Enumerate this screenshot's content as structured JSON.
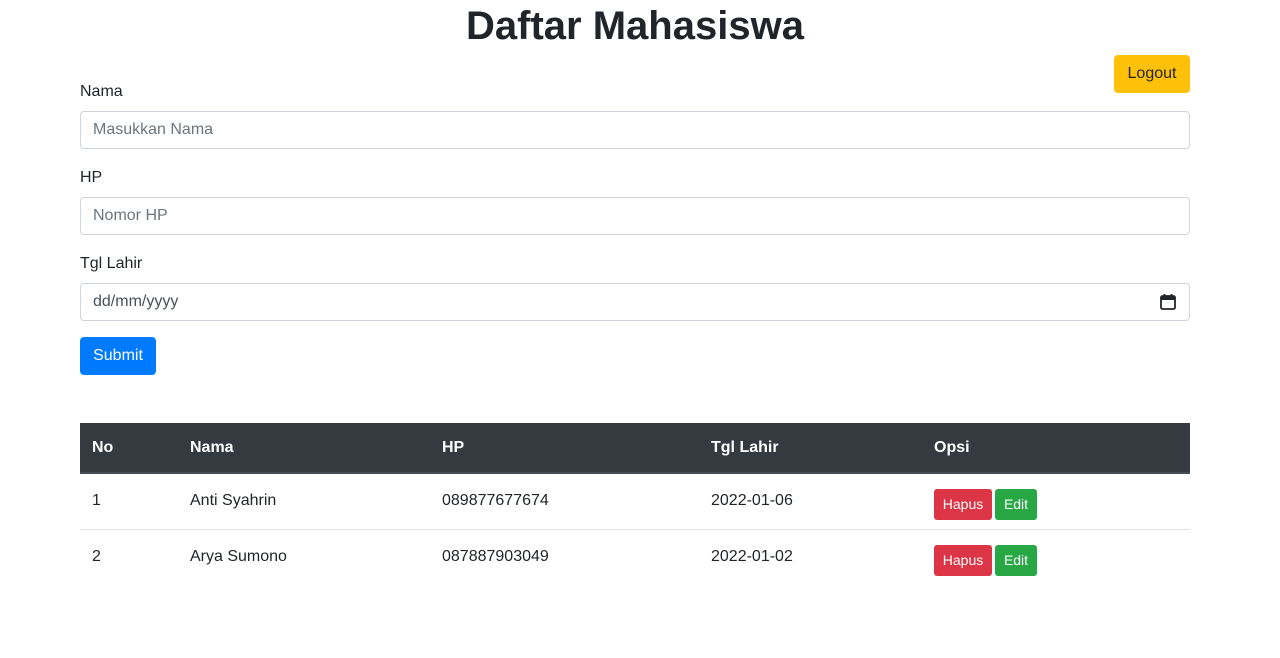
{
  "header": {
    "title": "Daftar Mahasiswa",
    "logout_label": "Logout"
  },
  "form": {
    "nama_label": "Nama",
    "nama_placeholder": "Masukkan Nama",
    "hp_label": "HP",
    "hp_placeholder": "Nomor HP",
    "tgl_label": "Tgl Lahir",
    "tgl_placeholder": "dd/mm/yyyy",
    "submit_label": "Submit"
  },
  "table": {
    "columns": [
      "No",
      "Nama",
      "HP",
      "Tgl Lahir",
      "Opsi"
    ],
    "rows": [
      {
        "no": "1",
        "nama": "Anti Syahrin",
        "hp": "089877677674",
        "tgl": "2022-01-06",
        "hapus": "Hapus",
        "edit": "Edit"
      },
      {
        "no": "2",
        "nama": "Arya Sumono",
        "hp": "087887903049",
        "tgl": "2022-01-02",
        "hapus": "Hapus",
        "edit": "Edit"
      }
    ]
  },
  "colors": {
    "primary": "#007bff",
    "warning": "#ffc107",
    "danger": "#dc3545",
    "success": "#28a745",
    "table_header": "#343a40"
  },
  "icons": {
    "date": "calendar-icon"
  }
}
